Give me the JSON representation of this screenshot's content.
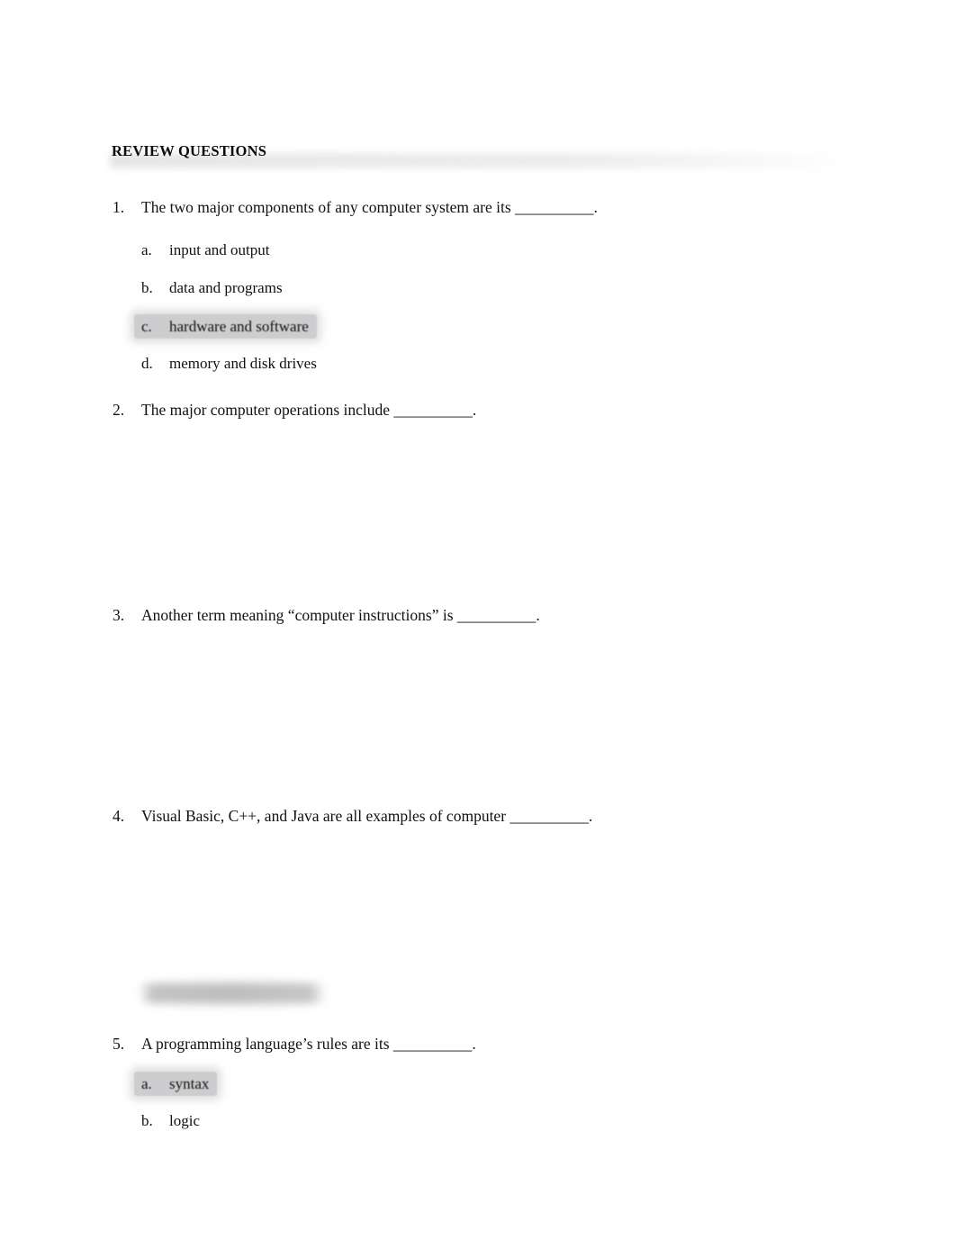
{
  "document": {
    "heading": "REVIEW QUESTIONS",
    "page_background": "#ffffff",
    "text_color": "#111111",
    "highlight_color": "#bababc",
    "header_band_color": "#e7e7e9",
    "redaction_color": "#bcbcbe"
  },
  "questions": [
    {
      "number": "1.",
      "text": "The two major components of any computer system are its __________.",
      "options": [
        {
          "letter": "a.",
          "text": "input and output",
          "marked": false
        },
        {
          "letter": "b.",
          "text": "data and programs",
          "marked": false
        },
        {
          "letter": "c.",
          "text": "hardware and software",
          "marked": true
        },
        {
          "letter": "d.",
          "text": "memory and disk drives",
          "marked": false
        }
      ]
    },
    {
      "number": "2.",
      "text": "The major computer operations include __________.",
      "options": []
    },
    {
      "number": "3.",
      "text": "Another term meaning “computer instructions” is __________.",
      "options": []
    },
    {
      "number": "4.",
      "text": "Visual Basic, C++, and Java are all examples of computer __________.",
      "options": []
    },
    {
      "number": "5.",
      "text": "A programming language’s rules are its __________.",
      "options": [
        {
          "letter": "a.",
          "text": "syntax",
          "marked": true
        },
        {
          "letter": "b.",
          "text": "logic",
          "marked": false
        }
      ]
    }
  ],
  "redaction": {
    "label": "redacted-text-block"
  }
}
